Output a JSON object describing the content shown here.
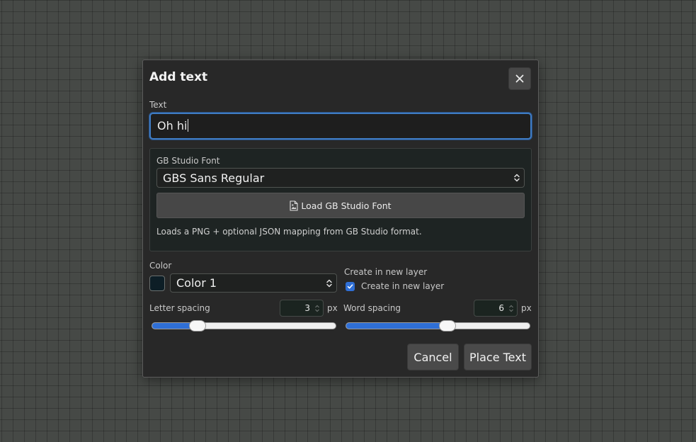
{
  "dialog": {
    "title": "Add text",
    "text_label": "Text",
    "text_value": "Oh hi",
    "font": {
      "label": "GB Studio Font",
      "selected": "GBS Sans Regular",
      "load_button": "Load GB Studio Font",
      "hint": "Loads a PNG + optional JSON mapping from GB Studio format."
    },
    "color": {
      "label": "Color",
      "selected": "Color 1",
      "swatch": "#0d1e26"
    },
    "new_layer": {
      "label": "Create in new layer",
      "checkbox_label": "Create in new layer",
      "checked": true
    },
    "letter_spacing": {
      "label": "Letter spacing",
      "value": "3",
      "unit": "px",
      "level": 0.25
    },
    "word_spacing": {
      "label": "Word spacing",
      "value": "6",
      "unit": "px",
      "level": 0.55
    },
    "buttons": {
      "cancel": "Cancel",
      "place": "Place Text"
    },
    "accent_color": "#2f6fd6"
  }
}
